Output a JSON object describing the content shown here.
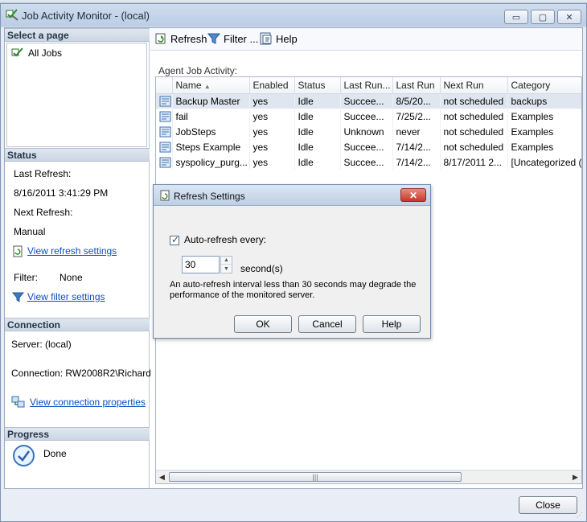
{
  "window": {
    "title": "Job Activity Monitor - (local)",
    "controls": {
      "minimize": "▭",
      "maximize": "▢",
      "close": "✕"
    }
  },
  "left": {
    "select_page": {
      "header": "Select a page",
      "items": [
        {
          "label": "All Jobs",
          "icon": "tools-icon"
        }
      ]
    },
    "status": {
      "header": "Status",
      "last_refresh_label": "Last Refresh:",
      "last_refresh_value": "8/16/2011 3:41:29 PM",
      "next_refresh_label": "Next Refresh:",
      "next_refresh_value": "Manual",
      "view_refresh_link": "View refresh settings",
      "filter_label": "Filter:",
      "filter_value": "None",
      "view_filter_link": "View filter settings"
    },
    "connection": {
      "header": "Connection",
      "server_text": "Server: (local)",
      "connection_text": "Connection: RW2008R2\\Richard",
      "view_connection_link": "View connection properties"
    },
    "progress": {
      "header": "Progress",
      "status_text": "Done"
    }
  },
  "toolbar": {
    "refresh_label": "Refresh",
    "filter_label": "Filter ...",
    "help_label": "Help"
  },
  "grid": {
    "caption": "Agent Job Activity:",
    "columns": [
      "",
      "Name",
      "Enabled",
      "Status",
      "Last Run...",
      "Last Run",
      "Next Run",
      "Category"
    ],
    "sort_indicator": "▲",
    "rows": [
      {
        "name": "Backup Master",
        "enabled": "yes",
        "status": "Idle",
        "last_outcome": "Succee...",
        "last_run": "8/5/20...",
        "next_run": "not scheduled",
        "category": "backups",
        "selected": true
      },
      {
        "name": "fail",
        "enabled": "yes",
        "status": "Idle",
        "last_outcome": "Succee...",
        "last_run": "7/25/2...",
        "next_run": "not scheduled",
        "category": "Examples",
        "selected": false
      },
      {
        "name": "JobSteps",
        "enabled": "yes",
        "status": "Idle",
        "last_outcome": "Unknown",
        "last_run": "never",
        "next_run": "not scheduled",
        "category": "Examples",
        "selected": false
      },
      {
        "name": "Steps Example",
        "enabled": "yes",
        "status": "Idle",
        "last_outcome": "Succee...",
        "last_run": "7/14/2...",
        "next_run": "not scheduled",
        "category": "Examples",
        "selected": false
      },
      {
        "name": "syspolicy_purg...",
        "enabled": "yes",
        "status": "Idle",
        "last_outcome": "Succee...",
        "last_run": "7/14/2...",
        "next_run": "8/17/2011 2...",
        "category": "[Uncategorized (L...",
        "selected": false
      }
    ],
    "scroll": {
      "left": "◀",
      "right": "▶",
      "thumb_grip": "|||"
    }
  },
  "dialog": {
    "title": "Refresh Settings",
    "close_glyph": "✕",
    "auto_refresh_label": "Auto-refresh every:",
    "auto_refresh_checked": true,
    "interval_value": "30",
    "unit_label": "second(s)",
    "warning": "An auto-refresh interval less than 30 seconds may degrade the performance of the monitored server.",
    "ok_label": "OK",
    "cancel_label": "Cancel",
    "help_label": "Help",
    "spin_up": "▲",
    "spin_down": "▼"
  },
  "footer": {
    "close_label": "Close",
    "grip": "⋰"
  }
}
